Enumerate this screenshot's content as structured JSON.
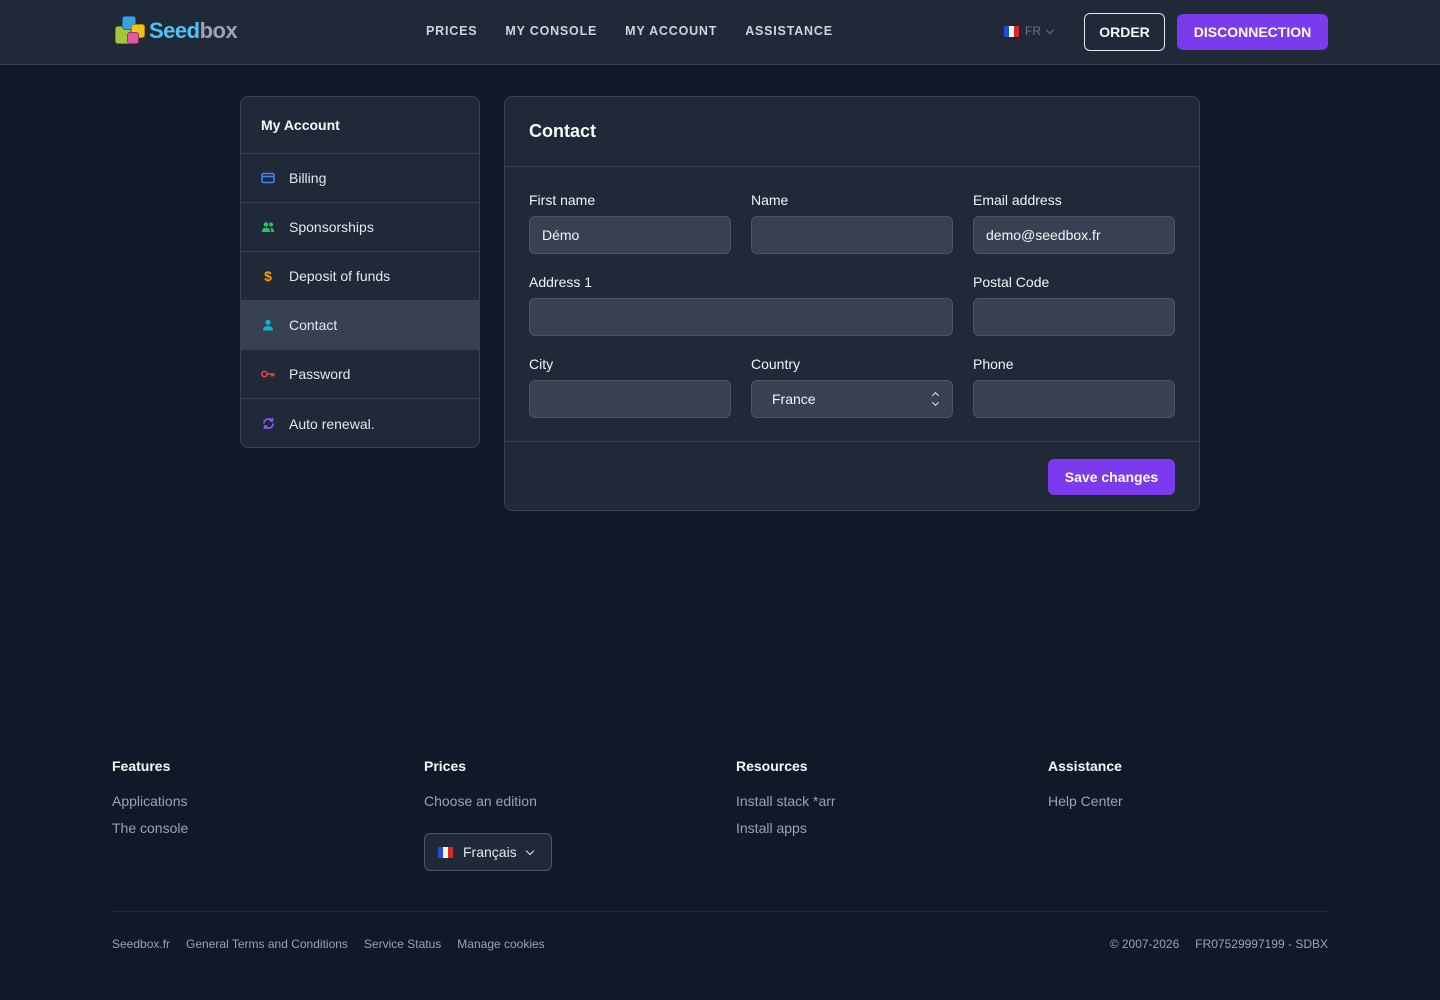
{
  "header": {
    "logo_text_1": "Seed",
    "logo_text_2": "box",
    "nav": [
      "PRICES",
      "MY CONSOLE",
      "MY ACCOUNT",
      "ASSISTANCE"
    ],
    "lang": "FR",
    "order_label": "ORDER",
    "disconnect_label": "DISCONNECTION"
  },
  "sidebar": {
    "title": "My Account",
    "items": [
      {
        "label": "Billing",
        "icon": "credit-card-icon",
        "color": "#3b82f6"
      },
      {
        "label": "Sponsorships",
        "icon": "users-icon",
        "color": "#22c55e"
      },
      {
        "label": "Deposit of funds",
        "icon": "dollar-icon",
        "color": "#f59e0b"
      },
      {
        "label": "Contact",
        "icon": "user-icon",
        "color": "#06b6d4",
        "active": true
      },
      {
        "label": "Password",
        "icon": "key-icon",
        "color": "#ef4444"
      },
      {
        "label": "Auto renewal.",
        "icon": "refresh-icon",
        "color": "#8b5cf6"
      }
    ]
  },
  "form": {
    "title": "Contact",
    "first_name": {
      "label": "First name",
      "value": "Démo"
    },
    "name": {
      "label": "Name",
      "value": ""
    },
    "email": {
      "label": "Email address",
      "value": "demo@seedbox.fr"
    },
    "address1": {
      "label": "Address 1",
      "value": ""
    },
    "postal_code": {
      "label": "Postal Code",
      "value": ""
    },
    "city": {
      "label": "City",
      "value": ""
    },
    "country": {
      "label": "Country",
      "value": "France"
    },
    "phone": {
      "label": "Phone",
      "value": ""
    },
    "save_label": "Save changes"
  },
  "footer": {
    "features": {
      "title": "Features",
      "links": [
        "Applications",
        "The console"
      ]
    },
    "prices": {
      "title": "Prices",
      "links": [
        "Choose an edition"
      ]
    },
    "resources": {
      "title": "Resources",
      "links": [
        "Install stack *arr",
        "Install apps"
      ]
    },
    "assistance": {
      "title": "Assistance",
      "links": [
        "Help Center"
      ]
    },
    "language": "Français",
    "legal": [
      "Seedbox.fr",
      "General Terms and Conditions",
      "Service Status",
      "Manage cookies"
    ],
    "copyright": "© 2007-2026",
    "company_id": "FR07529997199 - SDBX"
  },
  "colors": {
    "accent": "#7c3aed",
    "background": "#111827",
    "surface": "#1f2937"
  }
}
